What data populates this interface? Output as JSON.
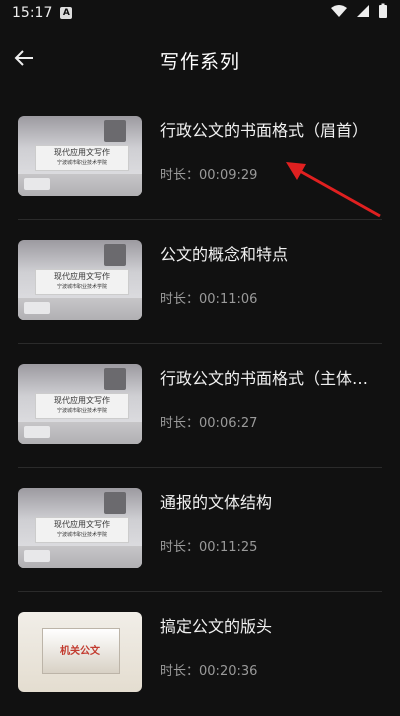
{
  "status": {
    "time": "15:17",
    "badge_icon": "A"
  },
  "header": {
    "title": "写作系列"
  },
  "thumbnails": {
    "banner_main": "现代应用文写作",
    "banner_sub": "宁波城市职业技术学院",
    "alt_stage_text": "机关公文"
  },
  "items": [
    {
      "title": "行政公文的书面格式（眉首）",
      "meta_label": "时长：",
      "duration": "00:09:29",
      "thumb_type": "standard"
    },
    {
      "title": "公文的概念和特点",
      "meta_label": "时长：",
      "duration": "00:11:06",
      "thumb_type": "standard"
    },
    {
      "title": "行政公文的书面格式（主体…",
      "meta_label": "时长：",
      "duration": "00:06:27",
      "thumb_type": "standard"
    },
    {
      "title": "通报的文体结构",
      "meta_label": "时长：",
      "duration": "00:11:25",
      "thumb_type": "standard"
    },
    {
      "title": "搞定公文的版头",
      "meta_label": "时长：",
      "duration": "00:20:36",
      "thumb_type": "alt"
    }
  ],
  "colors": {
    "background": "#111111",
    "accent_arrow": "#e02020"
  }
}
